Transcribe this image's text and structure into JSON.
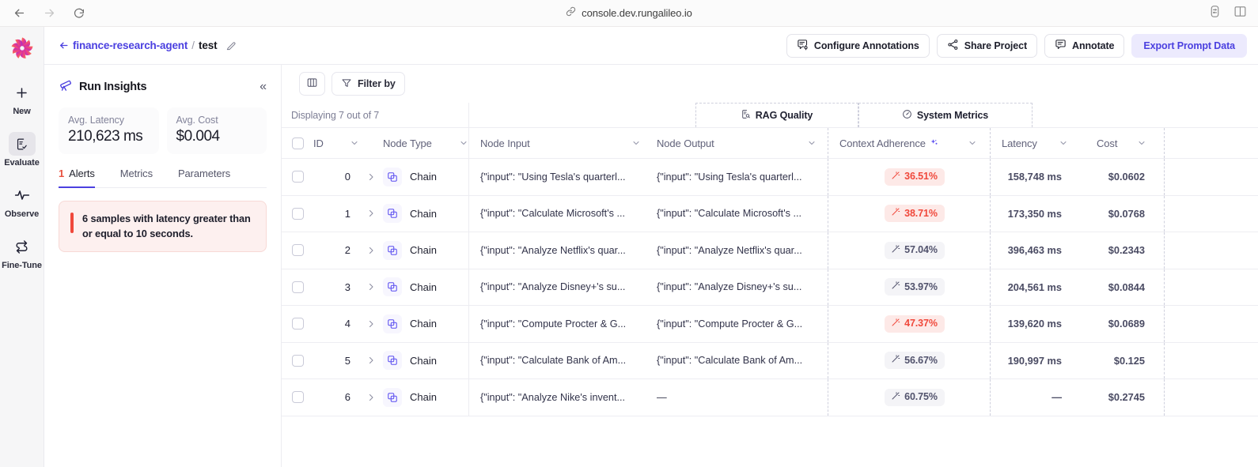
{
  "browser": {
    "back_icon": "arrow-left-icon",
    "forward_icon": "arrow-right-icon",
    "reload_icon": "reload-icon",
    "url": "console.dev.rungalileo.io",
    "link_icon": "link-icon",
    "right_icons": [
      "extensions-icon",
      "split-view-icon"
    ]
  },
  "header": {
    "back_arrow": "←",
    "project_name": "finance-research-agent",
    "separator": "/",
    "run_name": "test",
    "edit_icon": "pencil-edit-icon",
    "actions": [
      {
        "label": "Configure Annotations",
        "icon": "annotation-config-icon",
        "primary": false
      },
      {
        "label": "Share Project",
        "icon": "share-icon",
        "primary": false
      },
      {
        "label": "Annotate",
        "icon": "comment-icon",
        "primary": false
      },
      {
        "label": "Export Prompt Data",
        "icon": "",
        "primary": true
      }
    ]
  },
  "rail": {
    "logo": "galileo-logo",
    "items": [
      {
        "label": "New",
        "icon": "plus-icon",
        "active": false
      },
      {
        "label": "Evaluate",
        "icon": "document-check-icon",
        "active": true
      },
      {
        "label": "Observe",
        "icon": "pulse-activity-icon",
        "active": false
      },
      {
        "label": "Fine-Tune",
        "icon": "repeat-arrows-icon",
        "active": false
      }
    ]
  },
  "insights": {
    "title": "Run Insights",
    "icon": "telescope-icon",
    "collapse_icon": "chevrons-left-icon",
    "stats": [
      {
        "label": "Avg. Latency",
        "value": "210,623 ms"
      },
      {
        "label": "Avg. Cost",
        "value": "$0.004"
      }
    ],
    "tabs": [
      {
        "label": "Alerts",
        "count": "1",
        "active": true
      },
      {
        "label": "Metrics",
        "count": "",
        "active": false
      },
      {
        "label": "Parameters",
        "count": "",
        "active": false
      }
    ],
    "alert": {
      "text": "6 samples with latency greater than or equal to 10 seconds.",
      "accent_color": "#f0483b",
      "bg_color": "#fdf0ef"
    }
  },
  "table": {
    "toolbar": {
      "columns_icon": "columns-layout-icon",
      "filter_label": "Filter by",
      "filter_icon": "funnel-filter-icon"
    },
    "displaying": "Displaying 7 out of 7",
    "groups": [
      {
        "label": "RAG Quality",
        "icon": "document-search-icon"
      },
      {
        "label": "System Metrics",
        "icon": "gauge-icon"
      }
    ],
    "columns": {
      "id": "ID",
      "node_type": "Node Type",
      "node_input": "Node Input",
      "node_output": "Node Output",
      "context_adherence": "Context Adherence",
      "context_adherence_icon": "sparkles-icon",
      "latency": "Latency",
      "cost": "Cost"
    },
    "rows": [
      {
        "id": "0",
        "node_type": "Chain",
        "node_input": "{\"input\": \"Using Tesla's quarterl...",
        "node_output": "{\"input\": \"Using Tesla's quarterl...",
        "context_adherence": "36.51%",
        "adherence_state": "bad",
        "latency": "158,748 ms",
        "cost": "$0.0602"
      },
      {
        "id": "1",
        "node_type": "Chain",
        "node_input": "{\"input\": \"Calculate Microsoft's ...",
        "node_output": "{\"input\": \"Calculate Microsoft's ...",
        "context_adherence": "38.71%",
        "adherence_state": "bad",
        "latency": "173,350 ms",
        "cost": "$0.0768"
      },
      {
        "id": "2",
        "node_type": "Chain",
        "node_input": "{\"input\": \"Analyze Netflix's quar...",
        "node_output": "{\"input\": \"Analyze Netflix's quar...",
        "context_adherence": "57.04%",
        "adherence_state": "ok",
        "latency": "396,463 ms",
        "cost": "$0.2343"
      },
      {
        "id": "3",
        "node_type": "Chain",
        "node_input": "{\"input\": \"Analyze Disney+'s su...",
        "node_output": "{\"input\": \"Analyze Disney+'s su...",
        "context_adherence": "53.97%",
        "adherence_state": "ok",
        "latency": "204,561 ms",
        "cost": "$0.0844"
      },
      {
        "id": "4",
        "node_type": "Chain",
        "node_input": "{\"input\": \"Compute Procter & G...",
        "node_output": "{\"input\": \"Compute Procter & G...",
        "context_adherence": "47.37%",
        "adherence_state": "bad",
        "latency": "139,620 ms",
        "cost": "$0.0689"
      },
      {
        "id": "5",
        "node_type": "Chain",
        "node_input": "{\"input\": \"Calculate Bank of Am...",
        "node_output": "{\"input\": \"Calculate Bank of Am...",
        "context_adherence": "56.67%",
        "adherence_state": "ok",
        "latency": "190,997 ms",
        "cost": "$0.125"
      },
      {
        "id": "6",
        "node_type": "Chain",
        "node_input": "{\"input\": \"Analyze Nike's invent...",
        "node_output": "—",
        "context_adherence": "60.75%",
        "adherence_state": "ok",
        "latency": "—",
        "cost": "$0.2745"
      }
    ],
    "icons": {
      "chain": "chain-nodes-icon",
      "expander": "chevron-right-icon",
      "sort": "chevron-down-icon",
      "metric_badge": "wand-magic-icon"
    }
  },
  "colors": {
    "accent": "#4b40e0",
    "danger": "#f0483b",
    "neutral_badge": "#f4f4f7"
  }
}
